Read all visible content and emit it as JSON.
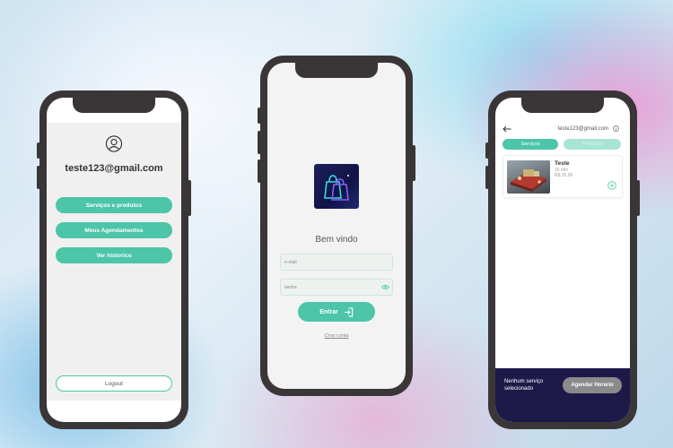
{
  "colors": {
    "accent": "#4cc5a8",
    "accent_light": "#a8e4d4",
    "footer_bg": "#1d1a4a",
    "phone_frame": "#3a3638"
  },
  "menu_screen": {
    "user_icon": "user-circle-icon",
    "email": "teste123@gmail.com",
    "buttons": [
      "Serviços e produtos",
      "Meus Agendamentos",
      "Ver historico"
    ],
    "logout_label": "Logout"
  },
  "login_screen": {
    "logo_icon": "shopping-bag-icon",
    "welcome": "Bem vindo",
    "email_placeholder": "e-mail",
    "password_placeholder": "senha",
    "password_icon": "eye-icon",
    "login_label": "Entrar",
    "login_icon": "login-arrow-icon",
    "create_account": "Criar conta"
  },
  "services_screen": {
    "back_icon": "arrow-left-icon",
    "email": "teste123@gmail.com",
    "info_icon": "info-icon",
    "tabs": [
      "Serviços",
      "Produtos"
    ],
    "card": {
      "title": "Teste",
      "duration": "15 min",
      "price": "R$ 20,00",
      "add_icon": "plus-circle-icon"
    },
    "footer_text": "Nenhum serviço selecionado",
    "schedule_label": "Agendar Horario"
  }
}
